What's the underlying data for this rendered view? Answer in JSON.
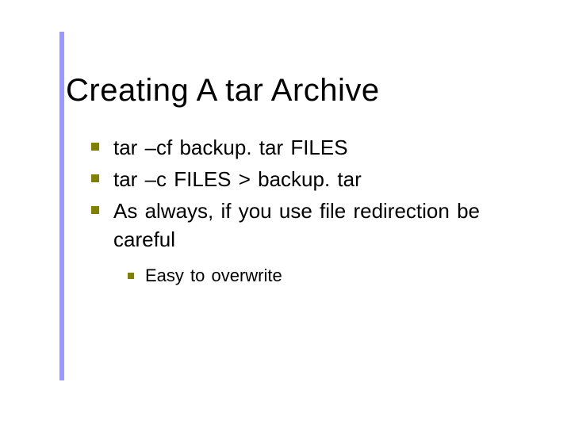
{
  "title": "Creating A tar Archive",
  "bullets": [
    {
      "text": "tar –cf backup. tar FILES"
    },
    {
      "text": "tar –c FILES > backup. tar"
    },
    {
      "text": "As always, if you use file redirection be careful"
    }
  ],
  "subbullets": [
    {
      "text": "Easy to overwrite"
    }
  ]
}
